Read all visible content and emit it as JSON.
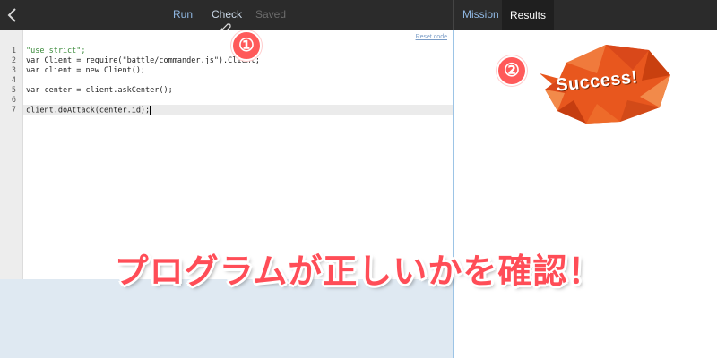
{
  "toolbar": {
    "run_label": "Run",
    "check_label": "Check",
    "saved_label": "Saved"
  },
  "right_tabs": {
    "mission_label": "Mission",
    "results_label": "Results"
  },
  "editor": {
    "reset_label": "Reset code",
    "line_numbers": [
      "1",
      "2",
      "3",
      "4",
      "5",
      "6",
      "7"
    ],
    "lines": [
      "\"use strict\";",
      "var Client = require(\"battle/commander.js\").Client;",
      "var client = new Client();",
      "",
      "var center = client.askCenter();",
      "",
      "client.doAttack(center.id);"
    ],
    "active_line": 7
  },
  "results": {
    "badge_text": "Success!"
  },
  "annotations": {
    "marker_1": "①",
    "marker_2": "②",
    "caption": "プログラムが正しいかを確認！"
  },
  "colors": {
    "topbar": "#2b2b2b",
    "accent_blue": "#8fb6e0",
    "badge_orange": "#e8571e",
    "caption_red": "#ff4d57"
  }
}
